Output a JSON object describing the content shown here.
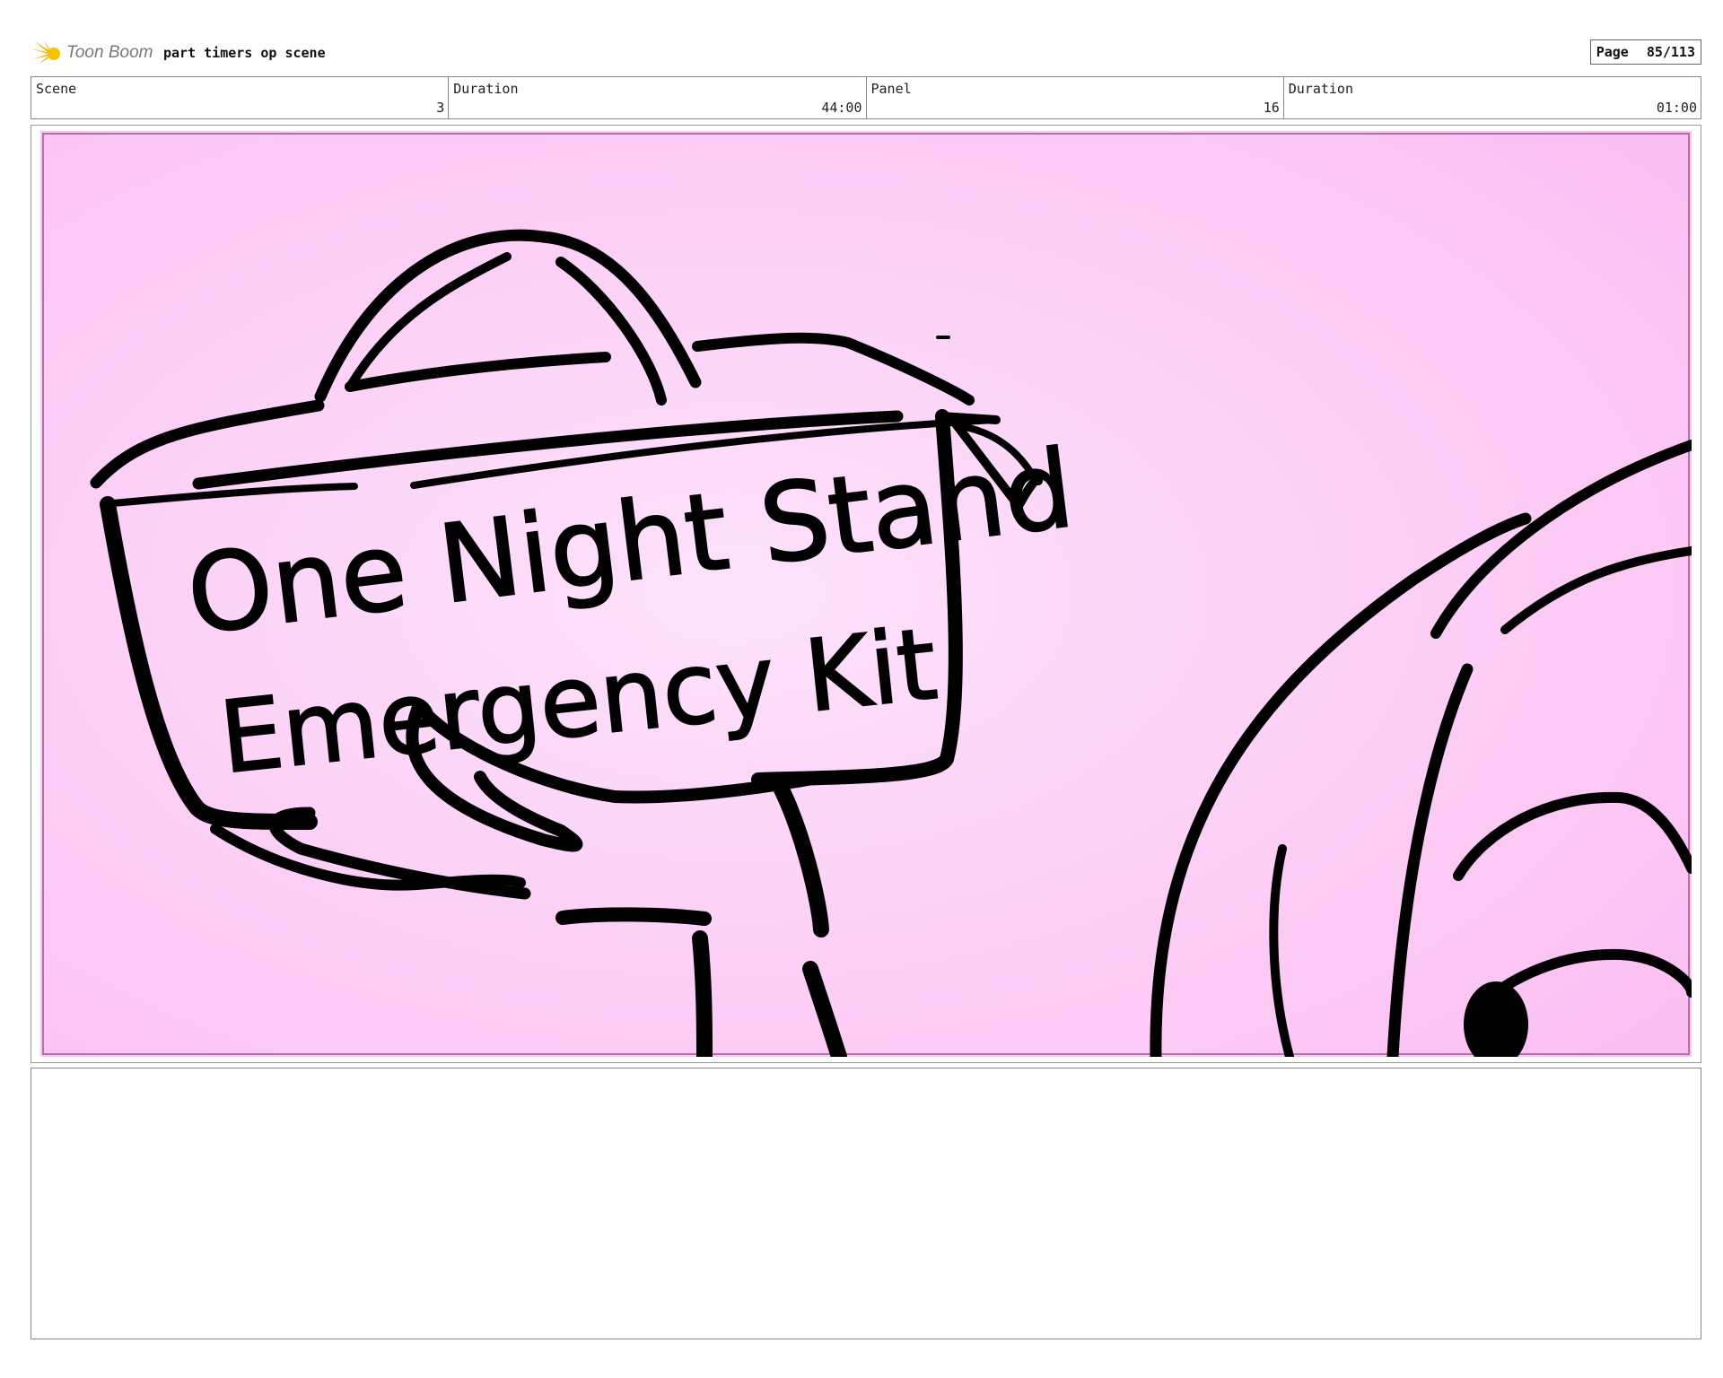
{
  "header": {
    "logo_text": "Toon Boom",
    "title": "part timers op scene",
    "page_label": "Page",
    "page_value": "85/113"
  },
  "info": [
    {
      "label": "Scene",
      "value": "3"
    },
    {
      "label": "Duration",
      "value": "44:00"
    },
    {
      "label": "Panel",
      "value": "16"
    },
    {
      "label": "Duration",
      "value": "01:00"
    }
  ],
  "panel": {
    "sign_line1": "One Night Stand",
    "sign_line2": "Emergency Kit",
    "background_color": "#fdd3f7",
    "border_color": "#b070a8"
  },
  "notes": {
    "text": ""
  }
}
